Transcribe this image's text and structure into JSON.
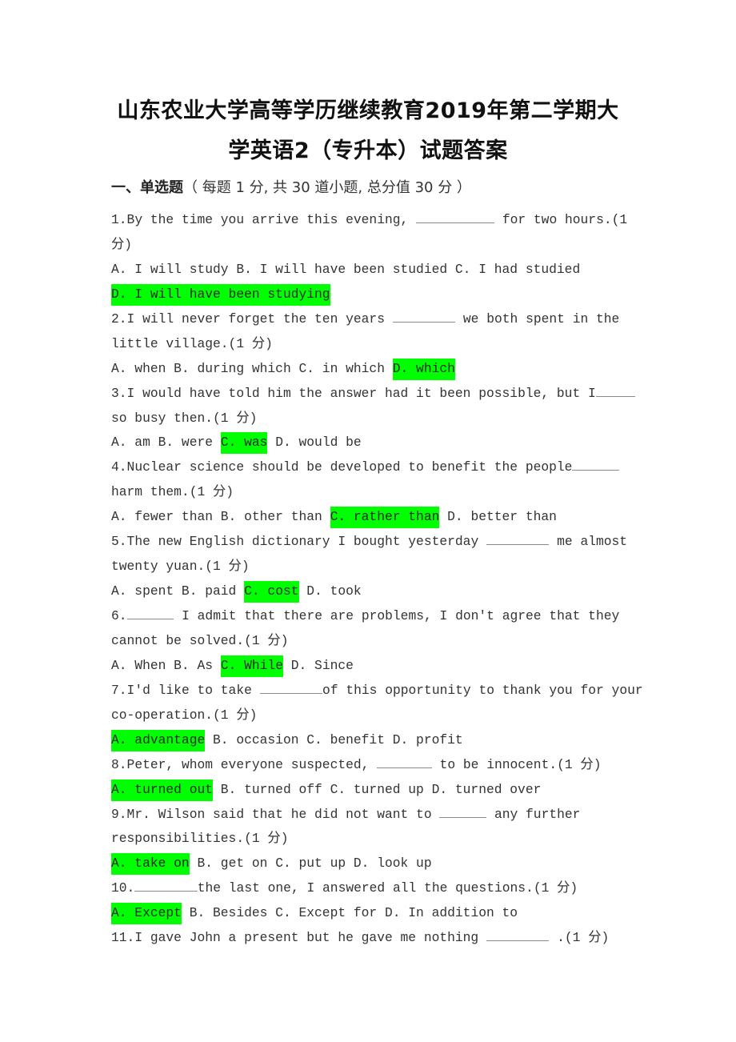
{
  "document": {
    "title_line1": "山东农业大学高等学历继续教育2019年第二学期大",
    "title_line2": "学英语2（专升本）试题答案",
    "section": {
      "heading": "一、单选题",
      "note": "（ 每题 1 分, 共 30 道小题, 总分值 30 分 ）"
    },
    "highlight_color": "#00ff00",
    "questions": [
      {
        "number": "1.",
        "stem_lines": [
          [
            "By the time you arrive this evening, ",
            "__________",
            " for two hours.(1"
          ],
          [
            "分)"
          ]
        ],
        "options_lines": [
          [
            {
              "text": "A. I will study B. I will have been studied C. I had studied",
              "correct": false
            }
          ],
          [
            {
              "text": "D. I will have been studying",
              "correct": true
            }
          ]
        ],
        "answer": "D"
      },
      {
        "number": "2.",
        "stem_lines": [
          [
            "I will never forget the ten years ",
            "________",
            " we both spent in the"
          ],
          [
            "little village.(1 分)"
          ]
        ],
        "options_lines": [
          [
            {
              "text": "A. when B. during which C. in which ",
              "correct": false
            },
            {
              "text": "D. which",
              "correct": true
            }
          ]
        ],
        "answer": "D"
      },
      {
        "number": "3.",
        "stem_lines": [
          [
            "I would have told him the answer had it been possible, but I",
            "_____",
            ""
          ],
          [
            "so busy then.(1 分)"
          ]
        ],
        "options_lines": [
          [
            {
              "text": "A. am B. were ",
              "correct": false
            },
            {
              "text": "C. was",
              "correct": true
            },
            {
              "text": " D. would be",
              "correct": false
            }
          ]
        ],
        "answer": "C"
      },
      {
        "number": "4.",
        "stem_lines": [
          [
            "Nuclear science should be developed to benefit the people",
            "______",
            ""
          ],
          [
            "harm them.(1 分)"
          ]
        ],
        "options_lines": [
          [
            {
              "text": "A. fewer than B. other than ",
              "correct": false
            },
            {
              "text": "C. rather than",
              "correct": true
            },
            {
              "text": " D. better than",
              "correct": false
            }
          ]
        ],
        "answer": "C"
      },
      {
        "number": "5.",
        "stem_lines": [
          [
            "The new English dictionary I bought yesterday ",
            "________",
            " me almost"
          ],
          [
            "twenty yuan.(1 分)"
          ]
        ],
        "options_lines": [
          [
            {
              "text": "A. spent B. paid ",
              "correct": false
            },
            {
              "text": "C. cost",
              "correct": true
            },
            {
              "text": " D. took",
              "correct": false
            }
          ]
        ],
        "answer": "C"
      },
      {
        "number": "6.",
        "stem_lines": [
          [
            "",
            "______",
            " I admit that there are problems, I don't agree that they"
          ],
          [
            "cannot be solved.(1 分)"
          ]
        ],
        "options_lines": [
          [
            {
              "text": "A. When B. As ",
              "correct": false
            },
            {
              "text": "C. While",
              "correct": true
            },
            {
              "text": " D. Since",
              "correct": false
            }
          ]
        ],
        "answer": "C"
      },
      {
        "number": "7.",
        "stem_lines": [
          [
            "I'd like to take ",
            "________",
            "of this opportunity to thank you for your"
          ],
          [
            "co-operation.(1 分)"
          ]
        ],
        "options_lines": [
          [
            {
              "text": "A. advantage",
              "correct": true
            },
            {
              "text": " B. occasion C. benefit D. profit",
              "correct": false
            }
          ]
        ],
        "answer": "A"
      },
      {
        "number": "8.",
        "stem_lines": [
          [
            "Peter, whom everyone suspected, ",
            "_______",
            " to be innocent.(1 分)"
          ]
        ],
        "options_lines": [
          [
            {
              "text": "A. turned out",
              "correct": true
            },
            {
              "text": " B. turned off C. turned up D. turned over",
              "correct": false
            }
          ]
        ],
        "answer": "A"
      },
      {
        "number": "9.",
        "stem_lines": [
          [
            "Mr. Wilson said that he did not want to ",
            "______",
            " any further"
          ],
          [
            "responsibilities.(1 分)"
          ]
        ],
        "options_lines": [
          [
            {
              "text": "A. take on",
              "correct": true
            },
            {
              "text": " B. get on C. put up D. look up",
              "correct": false
            }
          ]
        ],
        "answer": "A"
      },
      {
        "number": "10.",
        "stem_lines": [
          [
            "",
            "________",
            "the last one, I answered all the questions.(1 分)"
          ]
        ],
        "options_lines": [
          [
            {
              "text": "A. Except",
              "correct": true
            },
            {
              "text": " B. Besides C. Except for D. In addition to",
              "correct": false
            }
          ]
        ],
        "answer": "A"
      },
      {
        "number": "11.",
        "stem_lines": [
          [
            "I gave John a present but he gave me nothing ",
            "________",
            " .(1 分)"
          ]
        ],
        "options_lines": [],
        "answer": ""
      }
    ]
  }
}
